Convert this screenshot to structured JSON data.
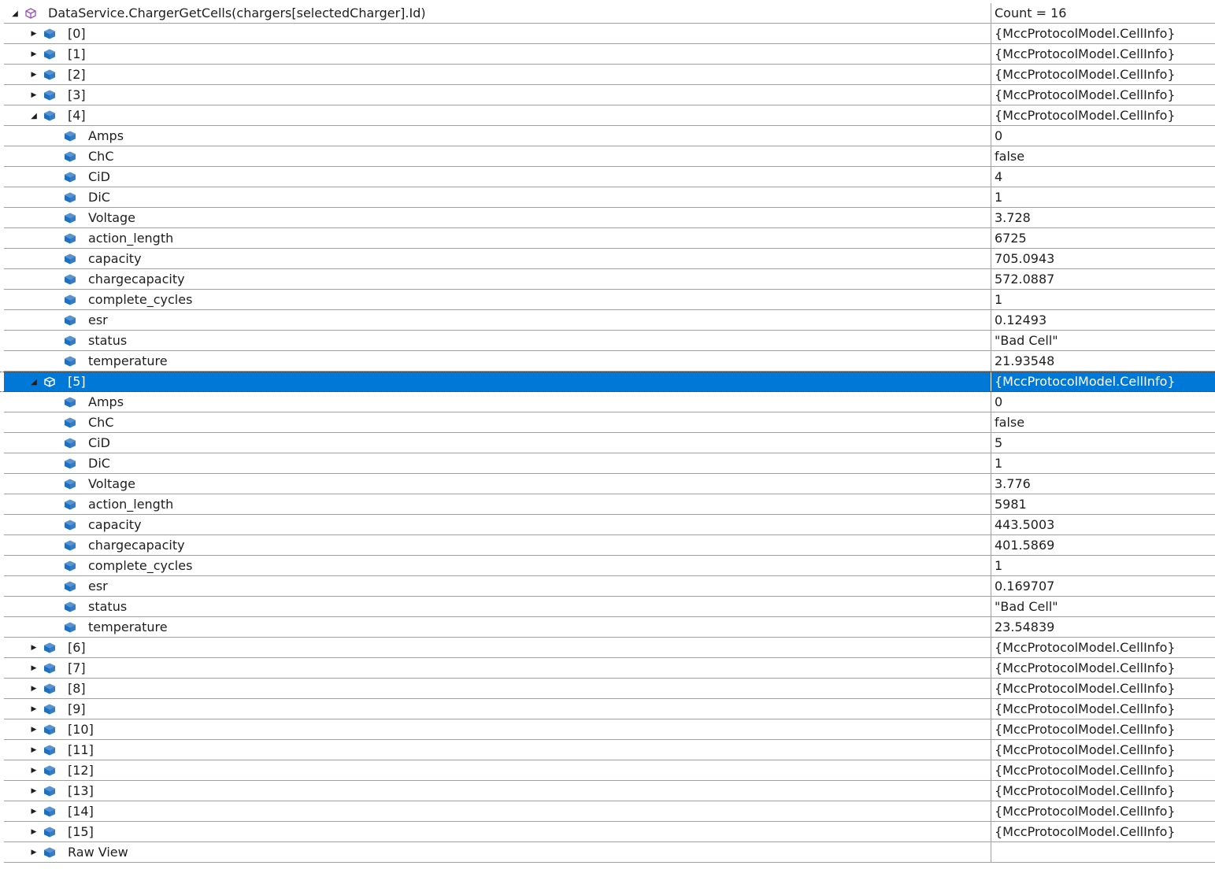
{
  "root": {
    "name": "DataService.ChargerGetCells(chargers[selectedCharger].Id)",
    "value": "Count = 16",
    "icon": "purple-cube-icon",
    "expanded": true
  },
  "rows": [
    {
      "name": "[0]",
      "value": "{MccProtocolModel.CellInfo}",
      "level": 1,
      "expandable": true,
      "expanded": false
    },
    {
      "name": "[1]",
      "value": "{MccProtocolModel.CellInfo}",
      "level": 1,
      "expandable": true,
      "expanded": false
    },
    {
      "name": "[2]",
      "value": "{MccProtocolModel.CellInfo}",
      "level": 1,
      "expandable": true,
      "expanded": false
    },
    {
      "name": "[3]",
      "value": "{MccProtocolModel.CellInfo}",
      "level": 1,
      "expandable": true,
      "expanded": false
    },
    {
      "name": "[4]",
      "value": "{MccProtocolModel.CellInfo}",
      "level": 1,
      "expandable": true,
      "expanded": true
    },
    {
      "name": "Amps",
      "value": "0",
      "level": 2
    },
    {
      "name": "ChC",
      "value": "false",
      "level": 2
    },
    {
      "name": "CiD",
      "value": "4",
      "level": 2
    },
    {
      "name": "DiC",
      "value": "1",
      "level": 2
    },
    {
      "name": "Voltage",
      "value": "3.728",
      "level": 2
    },
    {
      "name": "action_length",
      "value": "6725",
      "level": 2
    },
    {
      "name": "capacity",
      "value": "705.0943",
      "level": 2
    },
    {
      "name": "chargecapacity",
      "value": "572.0887",
      "level": 2
    },
    {
      "name": "complete_cycles",
      "value": "1",
      "level": 2
    },
    {
      "name": "esr",
      "value": "0.12493",
      "level": 2
    },
    {
      "name": "status",
      "value": "\"Bad Cell\"",
      "level": 2
    },
    {
      "name": "temperature",
      "value": "21.93548",
      "level": 2
    },
    {
      "name": "[5]",
      "value": "{MccProtocolModel.CellInfo}",
      "level": 1,
      "expandable": true,
      "expanded": true,
      "selected": true
    },
    {
      "name": "Amps",
      "value": "0",
      "level": 2
    },
    {
      "name": "ChC",
      "value": "false",
      "level": 2
    },
    {
      "name": "CiD",
      "value": "5",
      "level": 2
    },
    {
      "name": "DiC",
      "value": "1",
      "level": 2
    },
    {
      "name": "Voltage",
      "value": "3.776",
      "level": 2
    },
    {
      "name": "action_length",
      "value": "5981",
      "level": 2
    },
    {
      "name": "capacity",
      "value": "443.5003",
      "level": 2
    },
    {
      "name": "chargecapacity",
      "value": "401.5869",
      "level": 2
    },
    {
      "name": "complete_cycles",
      "value": "1",
      "level": 2
    },
    {
      "name": "esr",
      "value": "0.169707",
      "level": 2
    },
    {
      "name": "status",
      "value": "\"Bad Cell\"",
      "level": 2
    },
    {
      "name": "temperature",
      "value": "23.54839",
      "level": 2
    },
    {
      "name": "[6]",
      "value": "{MccProtocolModel.CellInfo}",
      "level": 1,
      "expandable": true,
      "expanded": false
    },
    {
      "name": "[7]",
      "value": "{MccProtocolModel.CellInfo}",
      "level": 1,
      "expandable": true,
      "expanded": false
    },
    {
      "name": "[8]",
      "value": "{MccProtocolModel.CellInfo}",
      "level": 1,
      "expandable": true,
      "expanded": false
    },
    {
      "name": "[9]",
      "value": "{MccProtocolModel.CellInfo}",
      "level": 1,
      "expandable": true,
      "expanded": false
    },
    {
      "name": "[10]",
      "value": "{MccProtocolModel.CellInfo}",
      "level": 1,
      "expandable": true,
      "expanded": false
    },
    {
      "name": "[11]",
      "value": "{MccProtocolModel.CellInfo}",
      "level": 1,
      "expandable": true,
      "expanded": false
    },
    {
      "name": "[12]",
      "value": "{MccProtocolModel.CellInfo}",
      "level": 1,
      "expandable": true,
      "expanded": false
    },
    {
      "name": "[13]",
      "value": "{MccProtocolModel.CellInfo}",
      "level": 1,
      "expandable": true,
      "expanded": false
    },
    {
      "name": "[14]",
      "value": "{MccProtocolModel.CellInfo}",
      "level": 1,
      "expandable": true,
      "expanded": false
    },
    {
      "name": "[15]",
      "value": "{MccProtocolModel.CellInfo}",
      "level": 1,
      "expandable": true,
      "expanded": false
    },
    {
      "name": "Raw View",
      "value": "",
      "level": 1,
      "expandable": true,
      "expanded": false
    }
  ],
  "colors": {
    "member_icon": "#1e6fc0",
    "root_icon": "#9b4fb5",
    "selection": "#0078d7",
    "grid": "#a0a0a0"
  }
}
